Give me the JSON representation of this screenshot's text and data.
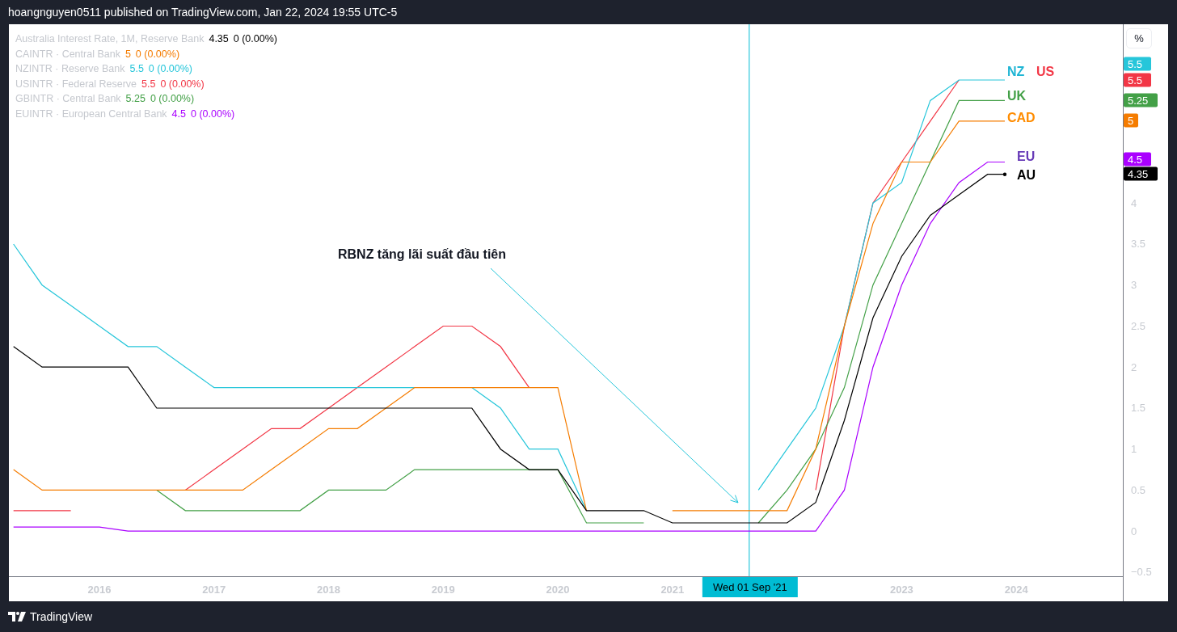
{
  "header": {
    "text": "hoangnguyen0511 published on TradingView.com, Jan 22, 2024 19:55 UTC-5"
  },
  "chart": {
    "legend": [
      {
        "value": "4.35",
        "change": "0 (0.00%)"
      },
      {
        "value": "5",
        "change": "0 (0.00%)"
      },
      {
        "value": "5.5",
        "change": "0 (0.00%)"
      },
      {
        "value": "5.5",
        "change": "0 (0.00%)"
      },
      {
        "value": "5.25",
        "change": "0 (0.00%)"
      },
      {
        "value": "4.5",
        "change": "0 (0.00%)"
      }
    ],
    "scale_button": "%",
    "line_labels": [
      {
        "text": "NZ",
        "color": "#1fb5d4"
      },
      {
        "text": "US",
        "color": "#f23645"
      },
      {
        "text": "UK",
        "color": "#43a047"
      },
      {
        "text": "CAD",
        "color": "#ff8c00"
      },
      {
        "text": "EU",
        "color": "#673ab7"
      },
      {
        "text": "AU",
        "color": "#000000"
      }
    ],
    "price_tags": [
      {
        "text": "5.5",
        "color": "#26c6da"
      },
      {
        "text": "5.5",
        "color": "#f23645"
      },
      {
        "text": "5.25",
        "color": "#43a047"
      },
      {
        "text": "5",
        "color": "#f57c00"
      },
      {
        "text": "4.5",
        "color": "#aa00ff"
      },
      {
        "text": "4.35",
        "color": "#000000"
      }
    ],
    "chart_data": {
      "type": "line",
      "xlim": [
        2015.21,
        2024.93
      ],
      "ylim": [
        -0.55,
        6.18
      ],
      "ref_lines": [
        {
          "axis": "x",
          "value": 2021.67,
          "label": "Wed 01 Sep '21"
        }
      ],
      "x": [
        2015.25,
        2015.5,
        2015.75,
        2016.0,
        2016.25,
        2016.5,
        2016.75,
        2017.0,
        2017.25,
        2017.5,
        2017.75,
        2018.0,
        2018.25,
        2018.5,
        2018.75,
        2019.0,
        2019.25,
        2019.5,
        2019.75,
        2020.0,
        2020.25,
        2020.5,
        2020.75,
        2021.0,
        2021.25,
        2021.5,
        2021.75,
        2022.0,
        2022.25,
        2022.5,
        2022.75,
        2023.0,
        2023.25,
        2023.5,
        2023.75,
        2023.9
      ],
      "series": [
        {
          "name": "Australia Interest Rate, 1M, Reserve Bank",
          "color": "#000000",
          "values": [
            2.25,
            2.0,
            2.0,
            2.0,
            2.0,
            1.5,
            1.5,
            1.5,
            1.5,
            1.5,
            1.5,
            1.5,
            1.5,
            1.5,
            1.5,
            1.5,
            1.5,
            1.0,
            0.75,
            0.75,
            0.25,
            0.25,
            0.25,
            0.1,
            0.1,
            0.1,
            0.1,
            0.1,
            0.35,
            1.35,
            2.6,
            3.35,
            3.85,
            4.1,
            4.35,
            4.35
          ]
        },
        {
          "name": "CAINTR · Central Bank",
          "color": "#f57c00",
          "values": [
            0.75,
            0.5,
            0.5,
            0.5,
            0.5,
            0.5,
            0.5,
            0.5,
            0.5,
            0.75,
            1.0,
            1.25,
            1.25,
            1.5,
            1.75,
            1.75,
            1.75,
            1.75,
            1.75,
            1.75,
            0.25,
            null,
            null,
            0.25,
            0.25,
            0.25,
            0.25,
            0.25,
            1.0,
            2.5,
            3.75,
            4.5,
            4.5,
            5.0,
            5.0,
            5.0
          ]
        },
        {
          "name": "NZINTR · Reserve Bank",
          "color": "#26c6da",
          "values": [
            3.5,
            3.0,
            2.75,
            2.5,
            2.25,
            2.25,
            2.0,
            1.75,
            1.75,
            1.75,
            1.75,
            1.75,
            1.75,
            1.75,
            1.75,
            null,
            1.75,
            1.5,
            1.0,
            1.0,
            0.25,
            null,
            null,
            null,
            null,
            null,
            0.5,
            1.0,
            1.5,
            2.5,
            4.0,
            4.25,
            5.25,
            5.5,
            5.5,
            5.5
          ]
        },
        {
          "name": "USINTR · Federal Reserve",
          "color": "#f23645",
          "values": [
            0.25,
            0.25,
            0.25,
            null,
            null,
            null,
            0.5,
            0.75,
            1.0,
            1.25,
            1.25,
            1.5,
            1.75,
            2.0,
            2.25,
            2.5,
            2.5,
            2.25,
            1.75,
            null,
            null,
            null,
            null,
            null,
            null,
            null,
            null,
            null,
            0.5,
            2.5,
            4.0,
            4.5,
            5.0,
            5.5,
            null,
            null
          ]
        },
        {
          "name": "GBINTR · Central Bank",
          "color": "#43a047",
          "values": [
            null,
            null,
            null,
            null,
            null,
            0.5,
            0.25,
            0.25,
            0.25,
            0.25,
            0.25,
            0.5,
            0.5,
            0.5,
            0.75,
            0.75,
            0.75,
            0.75,
            0.75,
            0.75,
            0.1,
            0.1,
            0.1,
            null,
            null,
            null,
            0.1,
            0.5,
            1.0,
            1.75,
            3.0,
            3.75,
            4.5,
            5.25,
            5.25,
            5.25
          ]
        },
        {
          "name": "EUINTR · European Central Bank",
          "color": "#aa00ff",
          "values": [
            0.05,
            0.05,
            0.05,
            0.05,
            0,
            0,
            0,
            0,
            0,
            0,
            0,
            0,
            0,
            0,
            0,
            0,
            0,
            0,
            0,
            0,
            0,
            0,
            0,
            0,
            0,
            0,
            0,
            0,
            0,
            0.5,
            2.0,
            3.0,
            3.75,
            4.25,
            4.5,
            4.5
          ]
        }
      ],
      "xticks": [
        2016,
        2017,
        2018,
        2019,
        2020,
        2021,
        2023,
        2024
      ],
      "yticks": [
        {
          "value": -0.5,
          "label": "−0.5"
        },
        0,
        0.5,
        1,
        1.5,
        2,
        2.5,
        3,
        3.5,
        4
      ],
      "annotations": [
        "RBNZ tăng lãi suất đầu tiên"
      ]
    }
  },
  "footer": {
    "brand": "TradingView"
  }
}
